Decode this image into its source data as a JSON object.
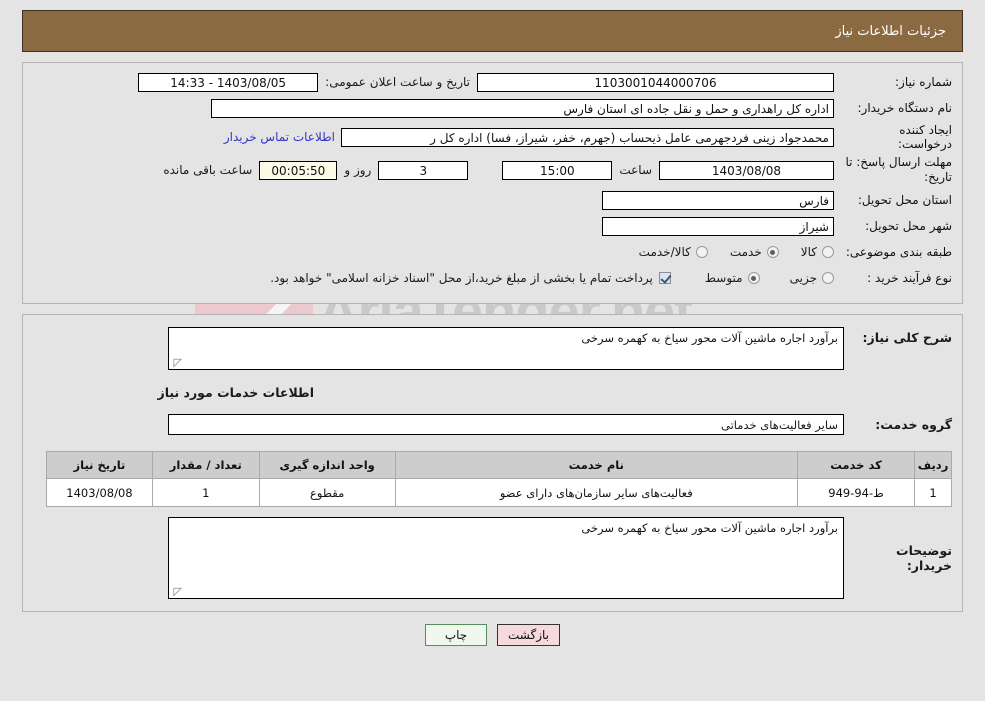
{
  "header": {
    "title": "جزئیات اطلاعات نیاز"
  },
  "form": {
    "need_number_label": "شماره نیاز:",
    "need_number_value": "1103001044000706",
    "publish_label": "تاریخ و ساعت اعلان عمومی:",
    "publish_value": "1403/08/05 - 14:33",
    "buyer_org_label": "نام دستگاه خریدار:",
    "buyer_org_value": "اداره کل راهداری و حمل و نقل جاده ای استان فارس",
    "requester_label": "ایجاد کننده درخواست:",
    "requester_value": "محمدجواد زینی فردجهرمی عامل ذیحساب (جهرم، خفر، شیراز، فسا) اداره کل ر",
    "contact_link": "اطلاعات تماس خریدار",
    "deadline_label": "مهلت ارسال پاسخ: تا تاریخ:",
    "deadline_date": "1403/08/08",
    "hour_label": "ساعت",
    "hour_value": "15:00",
    "days_value": "3",
    "days_label": "روز و",
    "countdown_value": "00:05:50",
    "countdown_label": "ساعت باقی مانده",
    "province_label": "استان محل تحویل:",
    "province_value": "فارس",
    "city_label": "شهر محل تحویل:",
    "city_value": "شیراز",
    "category_label": "طبقه بندی موضوعی:",
    "category_options": [
      {
        "label": "کالا",
        "selected": false
      },
      {
        "label": "خدمت",
        "selected": true
      },
      {
        "label": "کالا/خدمت",
        "selected": false
      }
    ],
    "process_label": "نوع فرآیند خرید :",
    "process_options": [
      {
        "label": "جزیی",
        "selected": false
      },
      {
        "label": "متوسط",
        "selected": true
      }
    ],
    "treasury_checked": true,
    "treasury_text": "پرداخت تمام یا بخشی از مبلغ خرید،از محل \"اسناد خزانه اسلامی\" خواهد بود."
  },
  "middle": {
    "general_desc_label": "شرح کلی نیاز:",
    "general_desc_value": "برآورد اجاره ماشین آلات محور سیاخ به کهمره سرخی",
    "services_section_title": "اطلاعات خدمات مورد نیاز",
    "service_group_label": "گروه خدمت:",
    "service_group_value": "سایر فعالیت‌های خدماتی"
  },
  "table": {
    "columns": [
      "ردیف",
      "کد خدمت",
      "نام خدمت",
      "واحد اندازه گیری",
      "تعداد / مقدار",
      "تاریخ نیاز"
    ],
    "rows": [
      {
        "radif": "1",
        "code": "ط-94-949",
        "name": "فعالیت‌های سایر سازمان‌های دارای عضو",
        "unit": "مقطوع",
        "qty": "1",
        "date": "1403/08/08"
      }
    ]
  },
  "buyer_notes": {
    "label": "توضیحات خریدار:",
    "value": "برآورد اجاره ماشین آلات محور سیاخ به کهمره سرخی"
  },
  "footer": {
    "print_label": "چاپ",
    "back_label": "بازگشت"
  },
  "watermark": {
    "text": "AriaTender.net"
  },
  "colors": {
    "header_bg": "#8b6a42",
    "link": "#3333cc",
    "table_header_bg": "#cdcdcd",
    "print_btn_bg": "#eef8ee",
    "back_btn_bg": "#f6d9dd",
    "countdown_bg": "#fbfbe8"
  }
}
